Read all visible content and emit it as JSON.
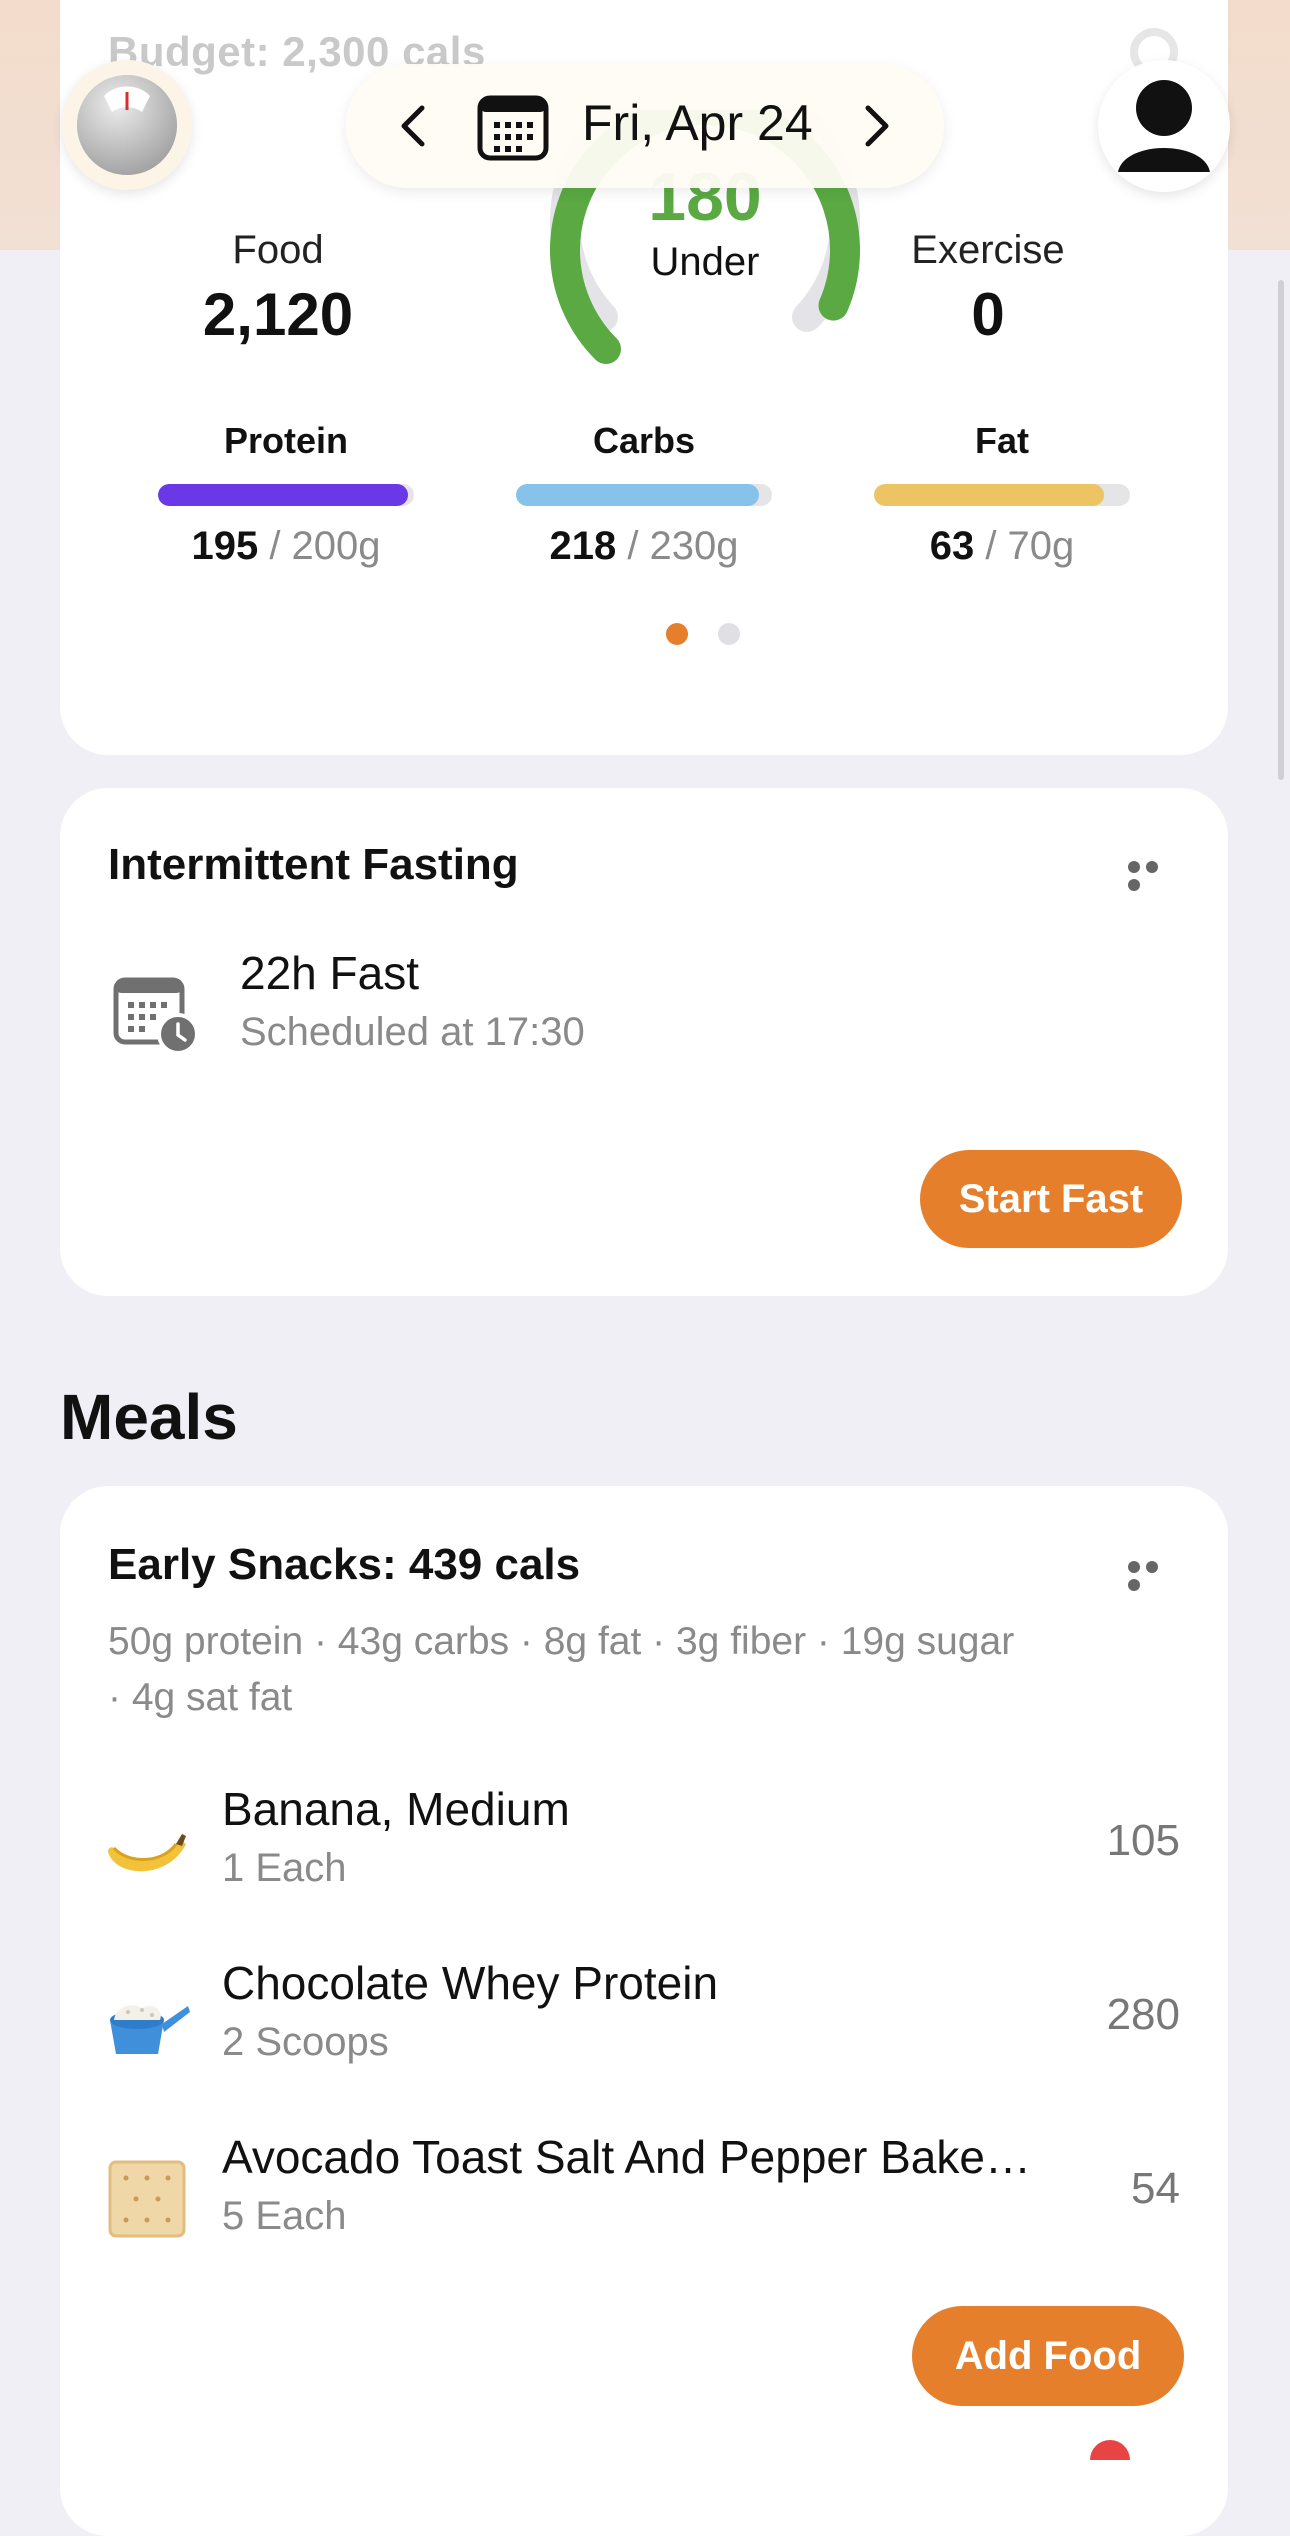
{
  "header": {
    "budget_text": "Budget: 2,300 cals",
    "date_label": "Fri, Apr 24"
  },
  "summary": {
    "food_label": "Food",
    "food_value": "2,120",
    "exercise_label": "Exercise",
    "exercise_value": "0",
    "remaining_value": "180",
    "remaining_label": "Under",
    "gauge_fraction": 0.92,
    "gauge_color": "#5aa943",
    "page_dots": {
      "count": 2,
      "active": 0
    }
  },
  "macros": [
    {
      "label": "Protein",
      "current": "195",
      "target": "200g",
      "fraction": 0.975,
      "color": "#6a38e6"
    },
    {
      "label": "Carbs",
      "current": "218",
      "target": "230g",
      "fraction": 0.948,
      "color": "#87c2ea"
    },
    {
      "label": "Fat",
      "current": "63",
      "target": "70g",
      "fraction": 0.9,
      "color": "#ecc463"
    }
  ],
  "fasting": {
    "title": "Intermittent Fasting",
    "fast_name": "22h Fast",
    "schedule": "Scheduled at 17:30",
    "start_button": "Start Fast"
  },
  "meals": {
    "heading": "Meals",
    "card": {
      "title": "Early Snacks: 439 cals",
      "macros_line": "50g protein · 43g carbs · 8g fat · 3g fiber · 19g sugar · 4g sat fat",
      "items": [
        {
          "name": "Banana, Medium",
          "qty": "1 Each",
          "cals": "105",
          "icon": "banana-icon"
        },
        {
          "name": "Chocolate Whey Protein",
          "qty": "2 Scoops",
          "cals": "280",
          "icon": "protein-scoop-icon"
        },
        {
          "name": "Avocado Toast Salt And Pepper Bake…",
          "qty": "5 Each",
          "cals": "54",
          "icon": "cracker-icon"
        }
      ],
      "add_button": "Add Food"
    }
  },
  "colors": {
    "accent": "#e57f2c",
    "background": "#efeff5"
  }
}
